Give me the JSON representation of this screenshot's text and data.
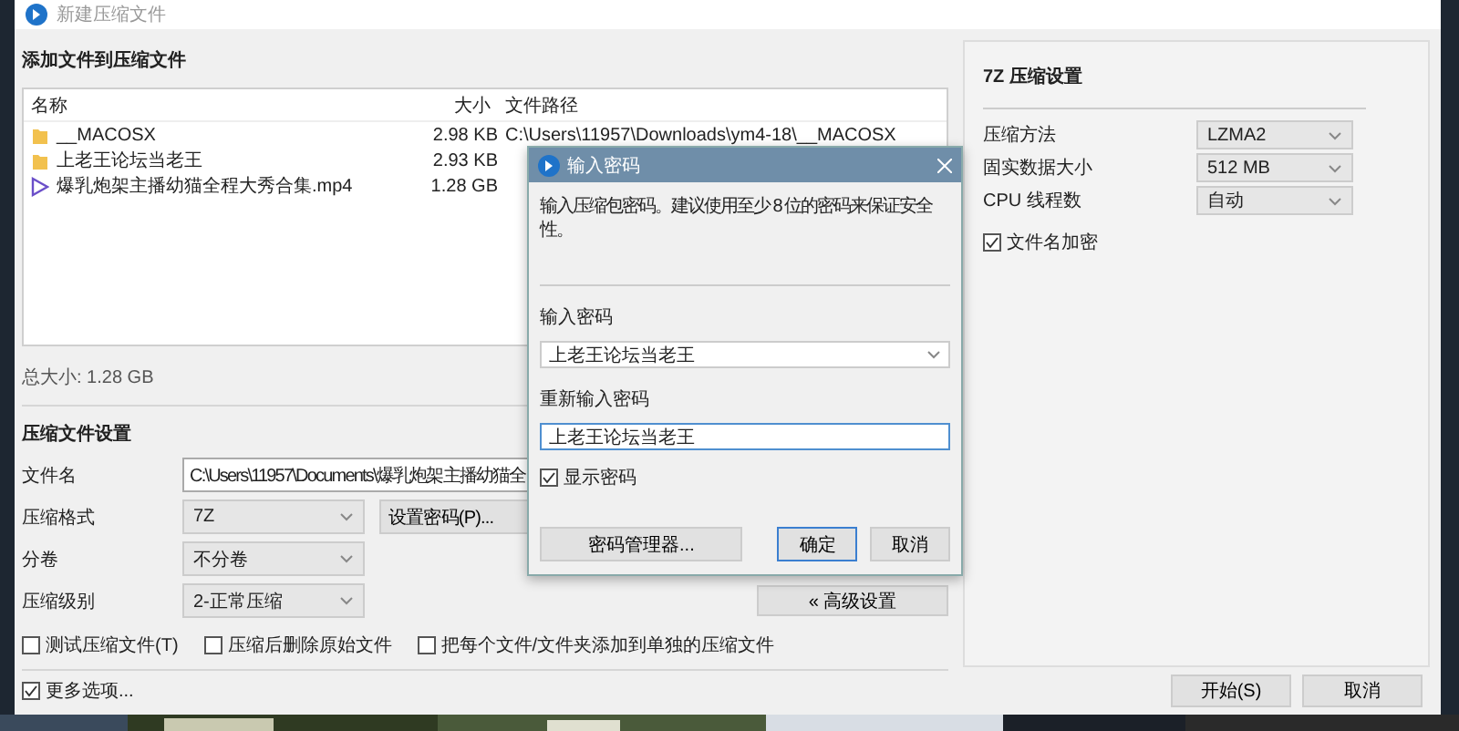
{
  "window": {
    "title": "新建压缩文件"
  },
  "files": {
    "heading": "添加文件到压缩文件",
    "columns": [
      "名称",
      "大小",
      "文件路径"
    ],
    "rows": [
      {
        "kind": "folder",
        "name": "__MACOSX",
        "size": "2.98 KB",
        "path": "C:\\Users\\11957\\Downloads\\ym4-18\\__MACOSX"
      },
      {
        "kind": "folder",
        "name": "上老王论坛当老王",
        "size": "2.93 KB"
      },
      {
        "kind": "video",
        "name": "爆乳炮架主播幼猫全程大秀合集.mp4",
        "size": "1.28 GB"
      }
    ],
    "total": "总大小: 1.28 GB"
  },
  "settings": {
    "heading": "压缩文件设置",
    "filename": {
      "label": "文件名",
      "value": "C:\\Users\\11957\\Documents\\爆乳炮架主播幼猫全"
    },
    "format": {
      "label": "压缩格式",
      "value": "7Z"
    },
    "password_button": "设置密码(P)...",
    "volume": {
      "label": "分卷",
      "value": "不分卷"
    },
    "level": {
      "label": "压缩级别",
      "value": "2-正常压缩"
    },
    "advanced_button": "« 高级设置",
    "options": [
      {
        "label": "测试压缩文件(T)",
        "checked": false
      },
      {
        "label": "压缩后删除原始文件",
        "checked": false
      },
      {
        "label": "把每个文件/文件夹添加到单独的压缩文件",
        "checked": false
      }
    ]
  },
  "advanced": {
    "heading": "7Z 压缩设置",
    "rows": [
      {
        "label": "压缩方法",
        "value": "LZMA2"
      },
      {
        "label": "固实数据大小",
        "value": "512 MB"
      },
      {
        "label": "CPU 线程数",
        "value": "自动"
      }
    ],
    "encrypt_names": {
      "label": "文件名加密",
      "checked": true
    }
  },
  "more_options": {
    "label": "更多选项...",
    "checked": true
  },
  "buttons": [
    "开始(S)",
    "取消"
  ],
  "dialog": {
    "title": "输入密码",
    "message": "输入压缩包密码。建议使用至少 8 位的密码来保证安全性。",
    "password_label": "输入密码",
    "password": "上老王论坛当老王",
    "confirm_label": "重新输入密码",
    "confirm": "上老王论坛当老王",
    "show_password": {
      "label": "显示密码",
      "checked": true
    },
    "buttons": [
      {
        "kind": "manager",
        "label": "密码管理器..."
      },
      {
        "kind": "default",
        "label": "确定"
      },
      {
        "kind": "normal",
        "label": "取消"
      }
    ]
  }
}
